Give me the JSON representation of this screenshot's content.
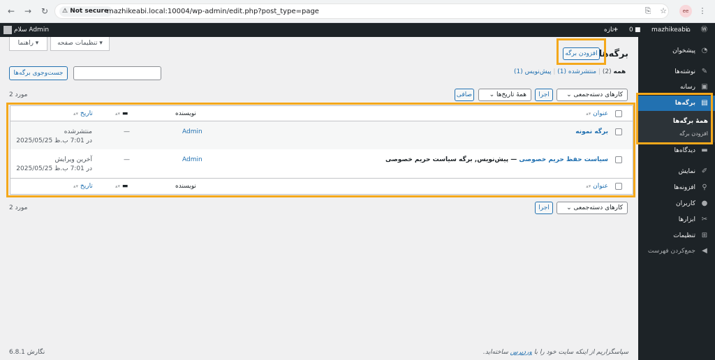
{
  "browser": {
    "not_secure": "Not secure",
    "url": "mazhikeabi.local:10004/wp-admin/edit.php?post_type=page",
    "profile": "ee"
  },
  "adminbar": {
    "site_name": "mazhikeabi",
    "comments_count": "0",
    "new_label": "تازه",
    "greeting": "سلام Admin"
  },
  "sidebar": {
    "items": [
      {
        "label": "پیشخوان",
        "icon": "dashboard-icon"
      },
      {
        "label": "نوشته‌ها",
        "icon": "pin-icon"
      },
      {
        "label": "رسانه",
        "icon": "media-icon"
      },
      {
        "label": "برگه‌ها",
        "icon": "page-icon"
      },
      {
        "label": "دیدگاه‌ها",
        "icon": "comment-icon"
      },
      {
        "label": "نمایش",
        "icon": "appearance-icon"
      },
      {
        "label": "افزونه‌ها",
        "icon": "plugin-icon"
      },
      {
        "label": "کاربران",
        "icon": "users-icon"
      },
      {
        "label": "ابزارها",
        "icon": "tools-icon"
      },
      {
        "label": "تنظیمات",
        "icon": "settings-icon"
      },
      {
        "label": "جمع‌کردن فهرست",
        "icon": "collapse-icon"
      }
    ],
    "submenu": [
      "همهٔ برگه‌ها",
      "افزودن برگه"
    ]
  },
  "screen_options": "تنظیمات صفحه ▾",
  "help": "راهنما ▾",
  "page_title": "برگه‌ها",
  "add_new": "افزودن برگه",
  "filters": {
    "all": "همه",
    "all_count": "(2)",
    "published": "منتشرشده (1)",
    "draft": "پیش‌نویس (1)",
    "sep": "|"
  },
  "search_button": "جست‌وجوی برگه‌ها",
  "search_placeholder": "",
  "bulk_actions": "کارهای دسته‌جمعی",
  "apply": "اجرا",
  "all_dates": "همهٔ تاریخ‌ها",
  "filter_button": "صافی",
  "items_count": "2 مورد",
  "table": {
    "col_title": "عنوان",
    "col_author": "نویسنده",
    "col_date": "تاریخ",
    "rows": [
      {
        "title": "برگه نمونه",
        "suffix": "",
        "author": "Admin",
        "comments": "—",
        "status": "منتشرشده",
        "date": "2025/05/25 در 7:01 ب.ظ"
      },
      {
        "title": "سیاست حفظ حریم خصوصی",
        "suffix": " — پیش‌نویس, برگه سیاست حریم خصوصی",
        "author": "Admin",
        "comments": "—",
        "status": "آخرین ویرایش",
        "date": "2025/05/25 در 7:01 ب.ظ"
      }
    ]
  },
  "footer": {
    "thanks_pre": "سپاسگزاریم از اینکه سایت خود را با ",
    "thanks_link": "وردپرس",
    "thanks_post": " ساخته‌اید.",
    "version": "نگارش 6.8.1"
  },
  "highlight_color": "#f4a81b",
  "accent_color": "#2271b1"
}
